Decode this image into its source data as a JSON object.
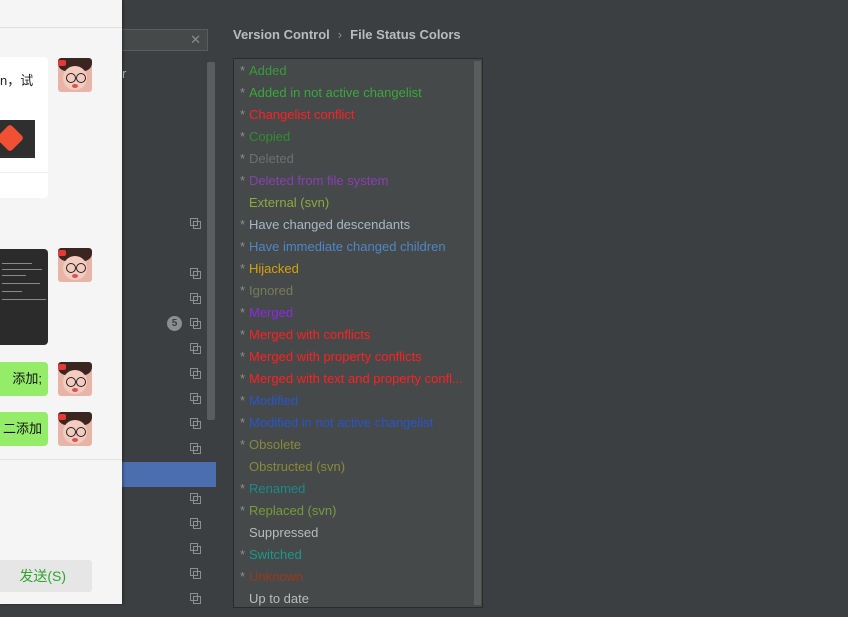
{
  "chat": {
    "message_text": "n，试",
    "green_messages": [
      "添加;",
      "二添加"
    ],
    "send_label": "发送(S)"
  },
  "tree": {
    "fragment": "r",
    "clear_icon": "close-icon",
    "badge_count": "5"
  },
  "breadcrumb": {
    "parent": "Version Control",
    "separator": "›",
    "current": "File Status Colors"
  },
  "file_statuses": [
    {
      "label": "Added",
      "star": "*",
      "color": "#3a9a3a"
    },
    {
      "label": "Added in not active changelist",
      "star": "*",
      "color": "#3aa83a"
    },
    {
      "label": "Changelist conflict",
      "star": "*",
      "color": "#ff2020"
    },
    {
      "label": "Copied",
      "star": "*",
      "color": "#2f8f2f"
    },
    {
      "label": "Deleted",
      "star": "*",
      "color": "#6f6f6f"
    },
    {
      "label": "Deleted from file system",
      "star": "*",
      "color": "#8a3fb0"
    },
    {
      "label": "External (svn)",
      "star": "",
      "color": "#8fa83f"
    },
    {
      "label": "Have changed descendants",
      "star": "*",
      "color": "#a9b7c6"
    },
    {
      "label": "Have immediate changed children",
      "star": "*",
      "color": "#4f86c6"
    },
    {
      "label": "Hijacked",
      "star": "*",
      "color": "#d4a20c"
    },
    {
      "label": "Ignored",
      "star": "*",
      "color": "#7a7a5a"
    },
    {
      "label": "Merged",
      "star": "*",
      "color": "#8a2be2"
    },
    {
      "label": "Merged with conflicts",
      "star": "*",
      "color": "#ff2020"
    },
    {
      "label": "Merged with property conflicts",
      "star": "*",
      "color": "#ff2020"
    },
    {
      "label": "Merged with text and property confl...",
      "star": "*",
      "color": "#ff2020"
    },
    {
      "label": "Modified",
      "star": "*",
      "color": "#2a55c9"
    },
    {
      "label": "Modified in not active changelist",
      "star": "*",
      "color": "#2a55c9"
    },
    {
      "label": "Obsolete",
      "star": "*",
      "color": "#8a8a3a"
    },
    {
      "label": "Obstructed (svn)",
      "star": "",
      "color": "#8a8a3a"
    },
    {
      "label": "Renamed",
      "star": "*",
      "color": "#1a8a8a"
    },
    {
      "label": "Replaced (svn)",
      "star": "*",
      "color": "#7a9a3a"
    },
    {
      "label": "Suppressed",
      "star": "",
      "color": "#bbbbbb"
    },
    {
      "label": "Switched",
      "star": "*",
      "color": "#1a9a8a"
    },
    {
      "label": "Unknown",
      "star": "*",
      "color": "#9a3a1a"
    },
    {
      "label": "Up to date",
      "star": "",
      "color": "#bbbbbb"
    }
  ]
}
